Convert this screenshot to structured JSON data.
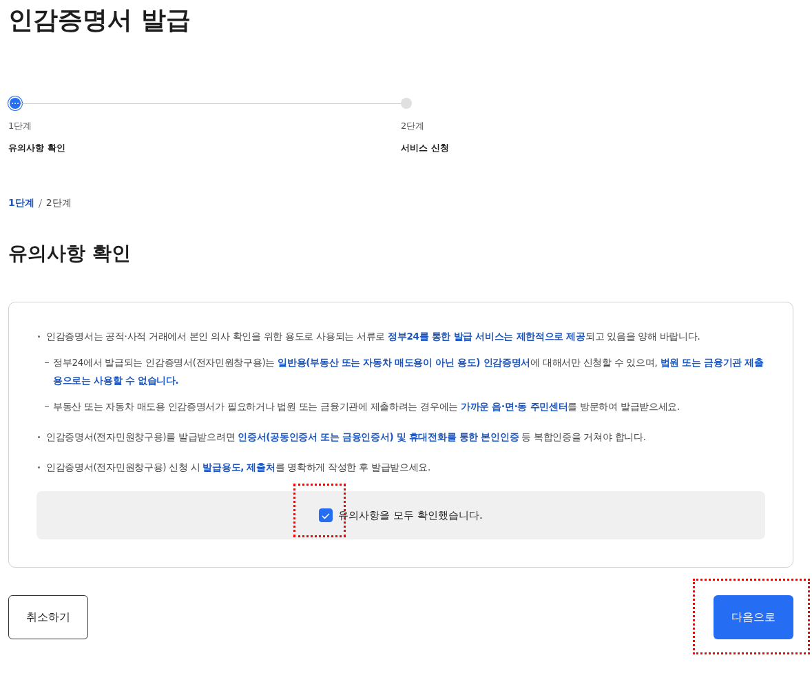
{
  "page_title": "인감증명서 발급",
  "steps": [
    {
      "number": "1단계",
      "label": "유의사항 확인",
      "selected": true
    },
    {
      "number": "2단계",
      "label": "서비스 신청",
      "selected": false
    }
  ],
  "breadcrumb": [
    {
      "label": "1단계",
      "selected": true
    },
    {
      "label": "2단계",
      "selected": false
    }
  ],
  "section_title": "유의사항 확인",
  "notices": [
    {
      "kind": "bullet",
      "text": "인감증명서는 공적·사적 거래에서 본인 의사 확인을 위한 용도로 사용되는 서류로 **정부24를 통한 발급 서비스는 제한적으로 제공**되고 있음을 양해 바랍니다."
    },
    {
      "kind": "dash",
      "text": "정부24에서 발급되는 인감증명서(전자민원창구용)는 **일반용(부동산 또는 자동차 매도용이 아닌 용도) 인감증명서**에 대해서만 신청할 수 있으며, **법원 또는 금융기관 제출용으로는 사용할 수 없습니다.**"
    },
    {
      "kind": "dash",
      "text": "부동산 또는 자동차 매도용 인감증명서가 필요하거나 법원 또는 금융기관에 제출하려는 경우에는 **가까운 읍·면·동 주민센터**를 방문하여 발급받으세요."
    },
    {
      "kind": "bullet",
      "text": "인감증명서(전자민원창구용)를 발급받으려면 **인증서(공동인증서 또는 금융인증서) 및 휴대전화를 통한 본인인증** 등 복합인증을 거쳐야 합니다."
    },
    {
      "kind": "bullet",
      "text": "인감증명서(전자민원창구용) 신청 시 **발급용도, 제출처**를 명확하게 작성한 후 발급받으세요."
    }
  ],
  "confirm": {
    "label": "유의사항을 모두 확인했습니다.",
    "checked": true,
    "highlighted": true
  },
  "buttons": {
    "cancel": {
      "label": "취소하기"
    },
    "next": {
      "label": "다음으로",
      "highlighted": true
    }
  }
}
